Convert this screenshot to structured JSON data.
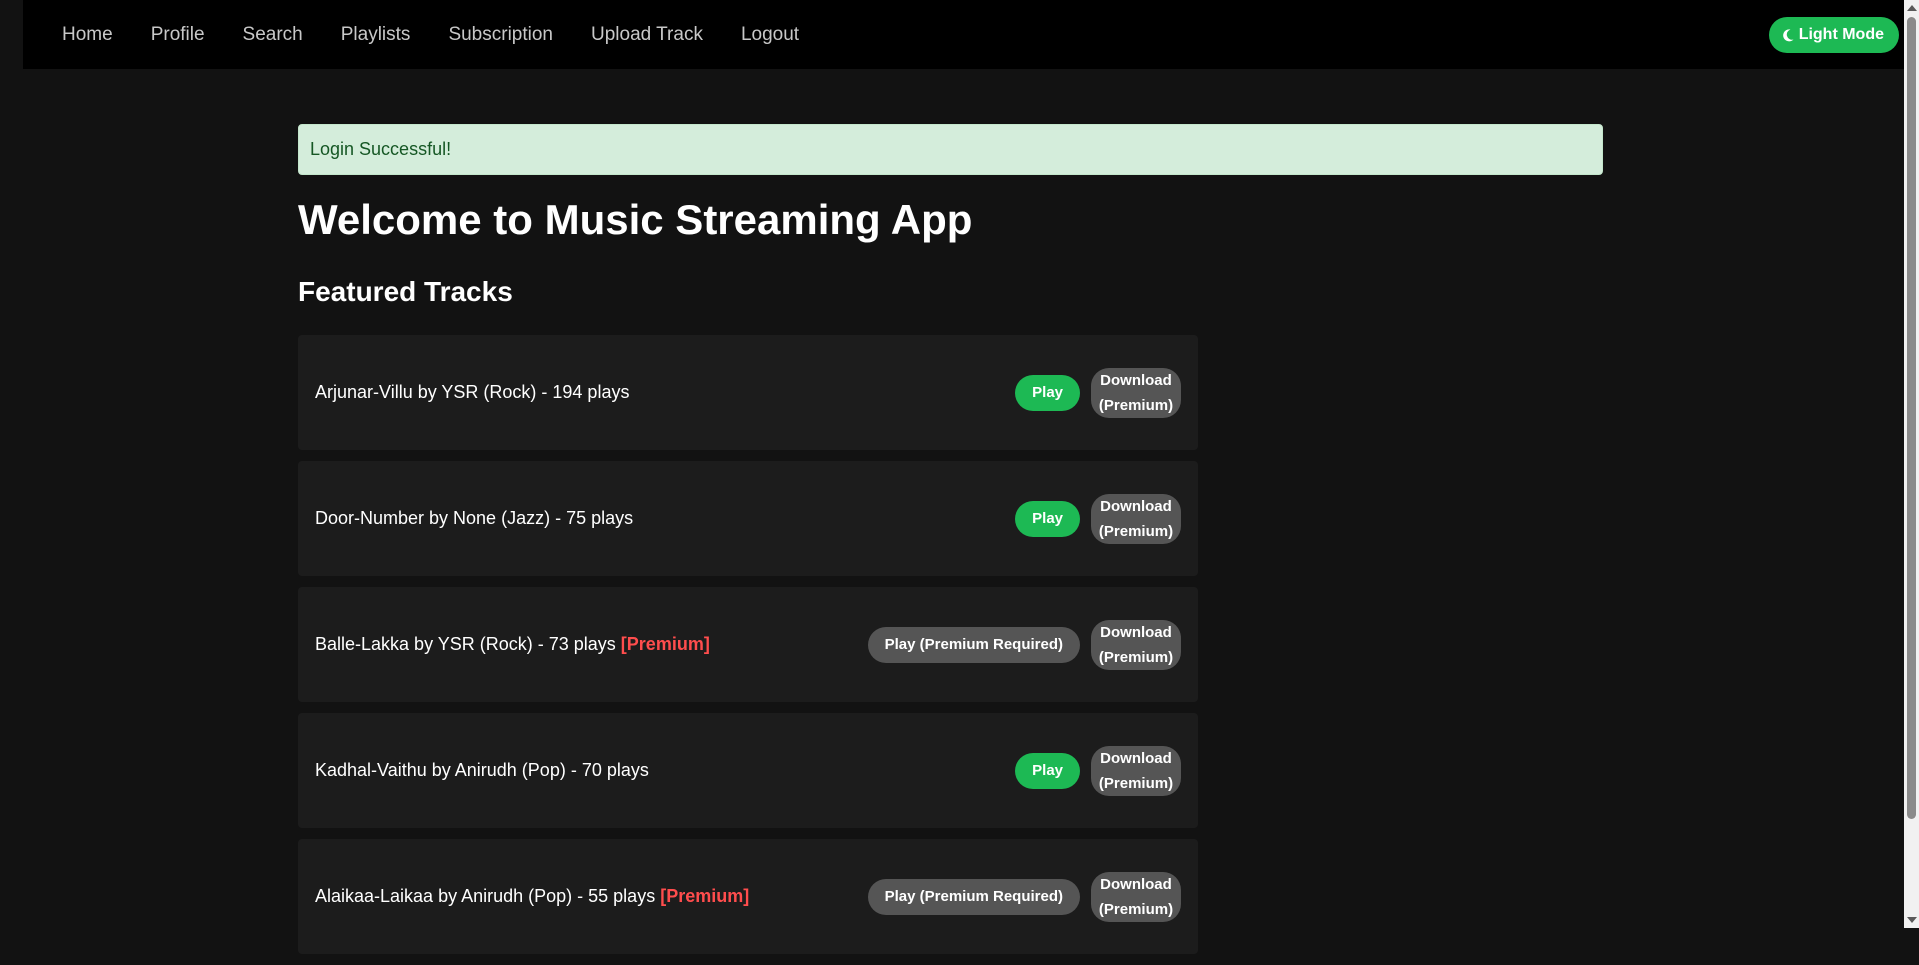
{
  "nav": {
    "links": [
      "Home",
      "Profile",
      "Search",
      "Playlists",
      "Subscription",
      "Upload Track",
      "Logout"
    ],
    "theme_toggle": {
      "label": "Light Mode",
      "icon": "moon-icon"
    }
  },
  "alert": {
    "message": "Login Successful!"
  },
  "page_title": "Welcome to Music Streaming App",
  "section_title": "Featured Tracks",
  "colors": {
    "accent": "#1db954",
    "premium": "#ff4d4d",
    "locked": "#555555"
  },
  "tracks": [
    {
      "info": "Arjunar-Villu by YSR (Rock) - 194 plays",
      "premium_tag": "",
      "play_label": "Play",
      "play_locked": false,
      "download_line1": "Download",
      "download_line2": "(Premium)"
    },
    {
      "info": "Door-Number by None (Jazz) - 75 plays",
      "premium_tag": "",
      "play_label": "Play",
      "play_locked": false,
      "download_line1": "Download",
      "download_line2": "(Premium)"
    },
    {
      "info": "Balle-Lakka by YSR (Rock) - 73 plays",
      "premium_tag": "[Premium]",
      "play_label": "Play (Premium Required)",
      "play_locked": true,
      "download_line1": "Download",
      "download_line2": "(Premium)"
    },
    {
      "info": "Kadhal-Vaithu by Anirudh (Pop) - 70 plays",
      "premium_tag": "",
      "play_label": "Play",
      "play_locked": false,
      "download_line1": "Download",
      "download_line2": "(Premium)"
    },
    {
      "info": "Alaikaa-Laikaa by Anirudh (Pop) - 55 plays",
      "premium_tag": "[Premium]",
      "play_label": "Play (Premium Required)",
      "play_locked": true,
      "download_line1": "Download",
      "download_line2": "(Premium)"
    }
  ]
}
